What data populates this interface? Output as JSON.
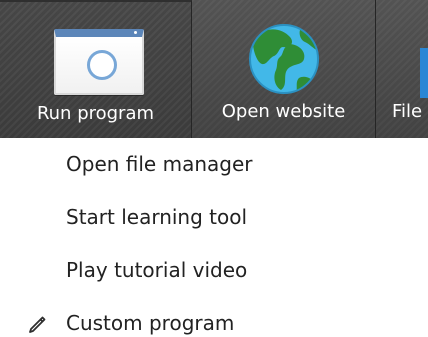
{
  "toolbar": {
    "buttons": [
      {
        "label": "Run program",
        "icon": "window-icon"
      },
      {
        "label": "Open website",
        "icon": "globe-icon"
      },
      {
        "label": "File",
        "icon": "file-icon"
      }
    ]
  },
  "menu": {
    "items": [
      {
        "label": "Open file manager"
      },
      {
        "label": "Start learning tool"
      },
      {
        "label": "Play tutorial video"
      },
      {
        "label": "Custom program",
        "icon": "pencil-icon"
      }
    ]
  },
  "colors": {
    "toolbar_background": "#4c4c4c",
    "toolbar_text": "#ffffff",
    "menu_background": "#ffffff",
    "menu_text": "#222222",
    "globe_water": "#42b8e8",
    "globe_land": "#2f8d36",
    "file_blue": "#2a86d5"
  }
}
